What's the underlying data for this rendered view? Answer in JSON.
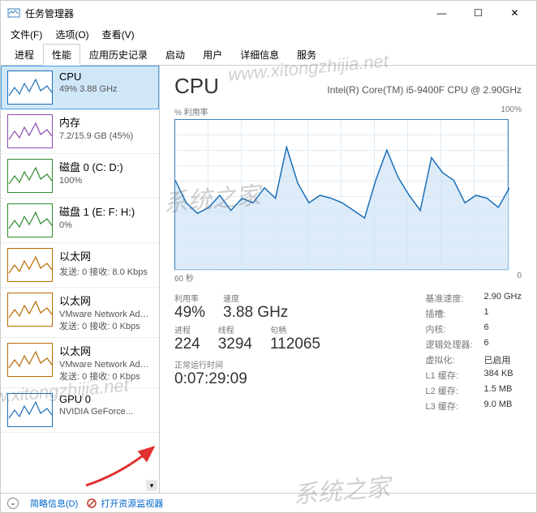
{
  "window": {
    "title": "任务管理器",
    "min": "—",
    "max": "☐",
    "close": "✕"
  },
  "menus": [
    "文件(F)",
    "选项(O)",
    "查看(V)"
  ],
  "tabs": [
    "进程",
    "性能",
    "应用历史记录",
    "启动",
    "用户",
    "详细信息",
    "服务"
  ],
  "active_tab": 1,
  "sidebar": [
    {
      "name": "cpu",
      "title": "CPU",
      "sub": "49% 3.88 GHz",
      "color": "#1c6fb8",
      "selected": true
    },
    {
      "name": "mem",
      "title": "内存",
      "sub": "7.2/15.9 GB (45%)",
      "color": "#8b4bb0"
    },
    {
      "name": "disk0",
      "title": "磁盘 0 (C: D:)",
      "sub": "100%",
      "color": "#2e8b2e"
    },
    {
      "name": "disk1",
      "title": "磁盘 1 (E: F: H:)",
      "sub": "0%",
      "color": "#2e8b2e"
    },
    {
      "name": "eth0",
      "title": "以太网",
      "sub": "发送: 0 接收: 8.0 Kbps",
      "color": "#b96a00"
    },
    {
      "name": "eth1",
      "title": "以太网",
      "sub": "VMware Network Adapter",
      "sub2": "发送: 0 接收: 0 Kbps",
      "color": "#b96a00"
    },
    {
      "name": "eth2",
      "title": "以太网",
      "sub": "VMware Network Adapter",
      "sub2": "发送: 0 接收: 0 Kbps",
      "color": "#b96a00"
    },
    {
      "name": "gpu0",
      "title": "GPU 0",
      "sub": "NVIDIA GeForce...",
      "color": "#1c6fb8"
    }
  ],
  "cpu": {
    "title": "CPU",
    "model": "Intel(R) Core(TM) i5-9400F CPU @ 2.90GHz",
    "chart_top_left": "% 利用率",
    "chart_top_right": "100%",
    "chart_bottom_left": "60 秒",
    "chart_bottom_right": "0",
    "stats1": [
      {
        "label": "利用率",
        "value": "49%"
      },
      {
        "label": "速度",
        "value": "3.88 GHz"
      }
    ],
    "stats2": [
      {
        "label": "进程",
        "value": "224"
      },
      {
        "label": "线程",
        "value": "3294"
      },
      {
        "label": "句柄",
        "value": "112065"
      }
    ],
    "uptime_label": "正常运行时间",
    "uptime_value": "0:07:29:09",
    "right": [
      {
        "label": "基准速度:",
        "value": "2.90 GHz"
      },
      {
        "label": "插槽:",
        "value": "1"
      },
      {
        "label": "内核:",
        "value": "6"
      },
      {
        "label": "逻辑处理器:",
        "value": "6"
      },
      {
        "label": "虚拟化:",
        "value": "已启用"
      },
      {
        "label": "L1 缓存:",
        "value": "384 KB"
      },
      {
        "label": "L2 缓存:",
        "value": "1.5 MB"
      },
      {
        "label": "L3 缓存:",
        "value": "9.0 MB"
      }
    ]
  },
  "footer": {
    "brief": "简略信息(D)",
    "monitor": "打开资源监视器"
  },
  "chart_data": {
    "type": "line",
    "title": "% 利用率",
    "xlabel": "60 秒 → 0",
    "ylabel": "% 利用率",
    "ylim": [
      0,
      100
    ],
    "x_seconds_ago": [
      60,
      58,
      56,
      54,
      52,
      50,
      48,
      46,
      44,
      42,
      40,
      38,
      36,
      34,
      32,
      30,
      28,
      26,
      24,
      22,
      20,
      18,
      16,
      14,
      12,
      10,
      8,
      6,
      4,
      2,
      0
    ],
    "values": [
      60,
      45,
      38,
      42,
      50,
      40,
      48,
      45,
      55,
      48,
      82,
      58,
      45,
      50,
      48,
      45,
      40,
      35,
      60,
      80,
      62,
      50,
      40,
      75,
      65,
      60,
      45,
      50,
      48,
      42,
      55
    ]
  },
  "watermarks": [
    "系统之家",
    "www.xitongzhijia.net"
  ]
}
